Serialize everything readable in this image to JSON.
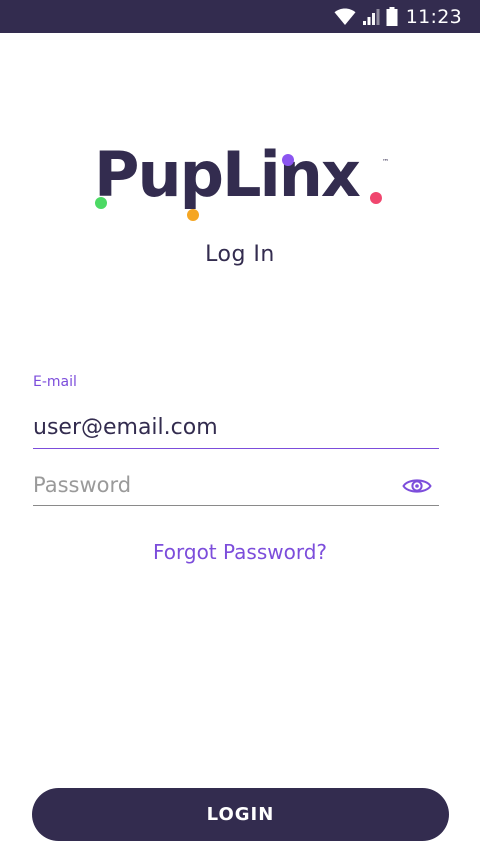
{
  "status_bar": {
    "time": "11:23",
    "icons": [
      "wifi-icon",
      "signal-icon",
      "battery-icon"
    ]
  },
  "brand": {
    "logo_text": "PupLinx",
    "trademark": "™",
    "dot_colors": [
      "#4cd964",
      "#f5a623",
      "#8b55f0",
      "#f0466e"
    ]
  },
  "page": {
    "title": "Log In"
  },
  "form": {
    "email_label": "E-mail",
    "email_value": "user@email.com",
    "password_placeholder": "Password",
    "password_value": "",
    "password_toggle_icon": "eye-icon"
  },
  "links": {
    "forgot_password": "Forgot Password?"
  },
  "actions": {
    "login_label": "LOGIN"
  },
  "colors": {
    "primary": "#332c4f",
    "accent": "#7c4ddb",
    "background": "#ffffff"
  }
}
